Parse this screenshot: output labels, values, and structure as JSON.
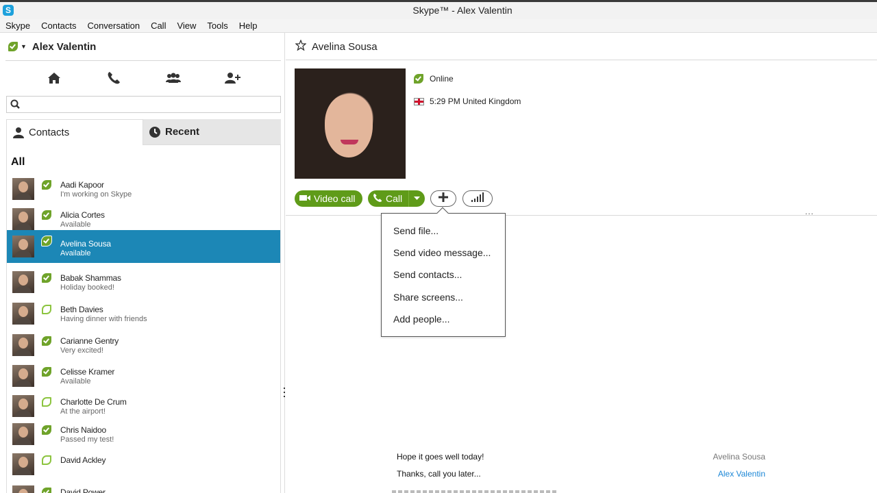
{
  "window": {
    "title": "Skype™ - Alex Valentin",
    "app_icon_letter": "S"
  },
  "menu_bar": [
    "Skype",
    "Contacts",
    "Conversation",
    "Call",
    "View",
    "Tools",
    "Help"
  ],
  "profile": {
    "name": "Alex Valentin",
    "status": "online"
  },
  "quick_icons": [
    "home-icon",
    "phone-icon",
    "group-icon",
    "add-contact-icon"
  ],
  "search": {
    "placeholder": "",
    "value": ""
  },
  "tabs": {
    "contacts": "Contacts",
    "recent": "Recent"
  },
  "contacts": {
    "group": "All",
    "items": [
      {
        "name": "Aadi Kapoor",
        "mood": "I'm working on Skype",
        "status": "online"
      },
      {
        "name": "Alicia Cortes",
        "mood": "Available",
        "status": "online"
      },
      {
        "name": "Avelina Sousa",
        "mood": "Available",
        "status": "online",
        "selected": true
      },
      {
        "name": "Babak Shammas",
        "mood": "Holiday booked!",
        "status": "online"
      },
      {
        "name": "Beth Davies",
        "mood": "Having dinner with friends",
        "status": "offline"
      },
      {
        "name": "Carianne Gentry",
        "mood": "Very excited!",
        "status": "online"
      },
      {
        "name": "Celisse Kramer",
        "mood": "Available",
        "status": "online"
      },
      {
        "name": "Charlotte De Crum",
        "mood": "At the airport!",
        "status": "offline"
      },
      {
        "name": "Chris Naidoo",
        "mood": "Passed my test!",
        "status": "online"
      },
      {
        "name": "David Ackley",
        "mood": "",
        "status": "offline"
      },
      {
        "name": "David Power",
        "mood": "",
        "status": "online"
      }
    ]
  },
  "conversation": {
    "contact_name": "Avelina Sousa",
    "presence": "Online",
    "local_time": "5:29 PM United Kingdom",
    "buttons": {
      "video_call": "Video call",
      "call": "Call"
    },
    "add_menu": [
      "Send file...",
      "Send video message...",
      "Send contacts...",
      "Share screens...",
      "Add people..."
    ],
    "ellipsis": "...",
    "messages": [
      {
        "from": "Avelina Sousa",
        "text": "Hope it goes well today!"
      },
      {
        "from": "Alex Valentin",
        "text": "Thanks, call you later..."
      }
    ]
  },
  "colors": {
    "accent_green": "#5f9b19",
    "selection_blue": "#1c87b6",
    "link_blue": "#1c87d6",
    "skype_blue": "#1da1dc"
  }
}
